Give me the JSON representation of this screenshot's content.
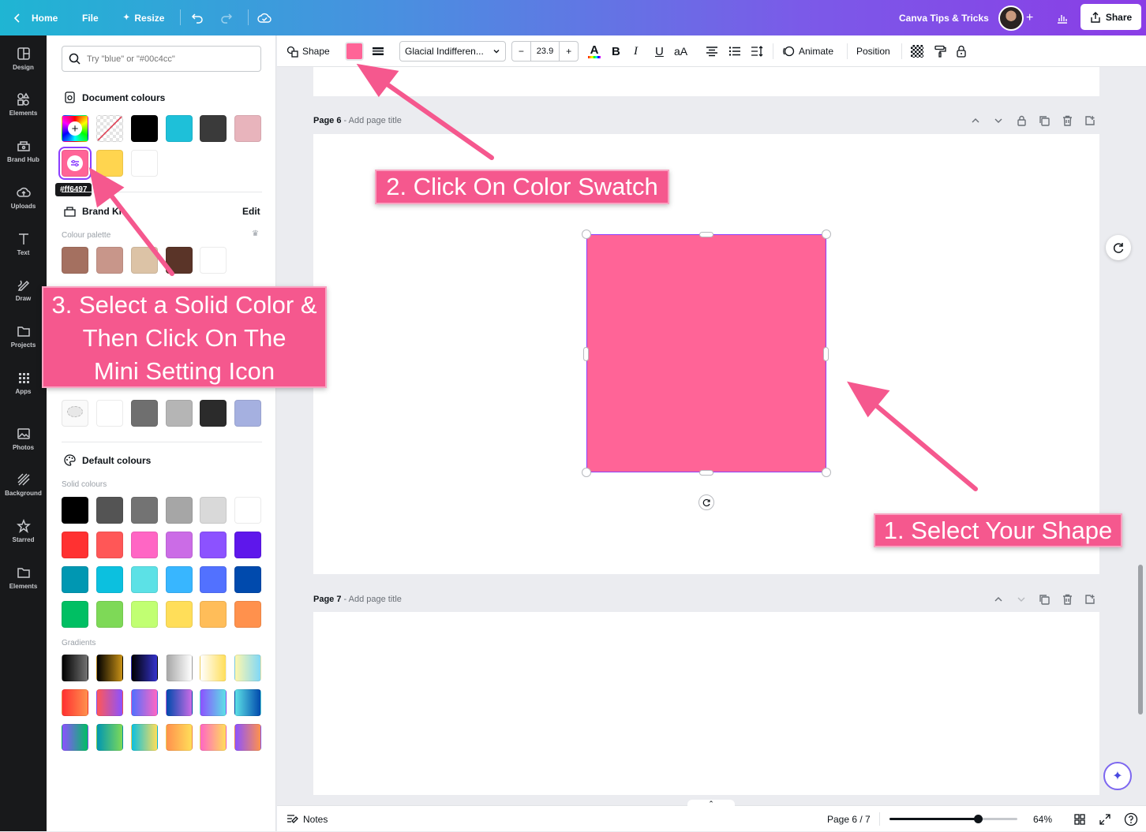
{
  "topbar": {
    "home": "Home",
    "file": "File",
    "resize": "Resize",
    "team": "Canva Tips & Tricks",
    "share": "Share"
  },
  "rail": {
    "items": [
      "Design",
      "Elements",
      "Brand Hub",
      "Uploads",
      "Text",
      "Draw",
      "Projects",
      "Apps",
      "Photos",
      "Background",
      "Starred",
      "Elements"
    ]
  },
  "panel": {
    "search_placeholder": "Try \"blue\" or \"#00c4cc\"",
    "document_colours": "Document colours",
    "tooltip": "#ff6497",
    "brand_kit": "Brand Ki",
    "edit": "Edit",
    "colour_palette": "Colour palette",
    "default_colours": "Default colours",
    "solid_colours": "Solid colours",
    "gradients": "Gradients",
    "doc_colors": [
      "#000000",
      "#1ec0d9",
      "#3a3a3a",
      "#e8b4bc",
      "#ff6497",
      "#ffd54f",
      "#ffffff"
    ],
    "brand_colors": [
      "#a47060",
      "#c8968a",
      "#dcc3a6",
      "#5a3428",
      "#ffffff"
    ],
    "palette2": [
      "#ffffff",
      "#6f6f6f",
      "#b5b5b5",
      "#2b2b2b",
      "#a5b0e0"
    ],
    "solid_rows": [
      [
        "#000000",
        "#545454",
        "#737373",
        "#a6a6a6",
        "#d9d9d9",
        "#ffffff"
      ],
      [
        "#ff3131",
        "#ff5757",
        "#ff66c4",
        "#cb6ce6",
        "#8c52ff",
        "#5e17eb"
      ],
      [
        "#0097b2",
        "#0cc0df",
        "#5ce1e6",
        "#38b6ff",
        "#5271ff",
        "#004aad"
      ],
      [
        "#00bf63",
        "#7ed957",
        "#c1ff72",
        "#ffde59",
        "#ffbd59",
        "#ff914d"
      ]
    ],
    "gradient_rows": [
      [
        [
          "#000000",
          "#737373"
        ],
        [
          "#000000",
          "#c89116"
        ],
        [
          "#000000",
          "#3533cd"
        ],
        [
          "#a6a6a6",
          "#ffffff"
        ],
        [
          "#ffffff",
          "#ffde59"
        ],
        [
          "#fff7ad",
          "#80d8f7"
        ]
      ],
      [
        [
          "#ff3131",
          "#ff914d"
        ],
        [
          "#ff5757",
          "#8c52ff"
        ],
        [
          "#5170ff",
          "#ff66c4"
        ],
        [
          "#004aad",
          "#cb6ce6"
        ],
        [
          "#8c52ff",
          "#5ce1e6"
        ],
        [
          "#5de0e6",
          "#004aad"
        ]
      ],
      [
        [
          "#8c52ff",
          "#00bf63"
        ],
        [
          "#0097b2",
          "#7ed957"
        ],
        [
          "#0cc0df",
          "#ffde59"
        ],
        [
          "#ff914d",
          "#ffde59"
        ],
        [
          "#ff66c4",
          "#ffde59"
        ],
        [
          "#8c52ff",
          "#ff914d"
        ]
      ]
    ]
  },
  "toolbar": {
    "shape": "Shape",
    "swatch_color": "#ff6497",
    "font": "Glacial Indifferen...",
    "size": "23.9",
    "bold": "B",
    "italic": "I",
    "underline": "U",
    "case": "aA",
    "animate": "Animate",
    "position": "Position"
  },
  "canvas": {
    "page6_label": "Page 6",
    "page6_title": " - Add page title",
    "page7_label": "Page 7",
    "page7_title": " - Add page title",
    "shape_color": "#ff6497"
  },
  "callouts": {
    "c1": "1. Select Your Shape",
    "c2": "2. Click On Color Swatch",
    "c3_l1": "3. Select a Solid Color &",
    "c3_l2": "Then Click On The",
    "c3_l3": "Mini Setting Icon"
  },
  "bottombar": {
    "notes": "Notes",
    "page_indicator": "Page 6 / 7",
    "zoom": "64%",
    "zoom_fraction": 0.64
  }
}
